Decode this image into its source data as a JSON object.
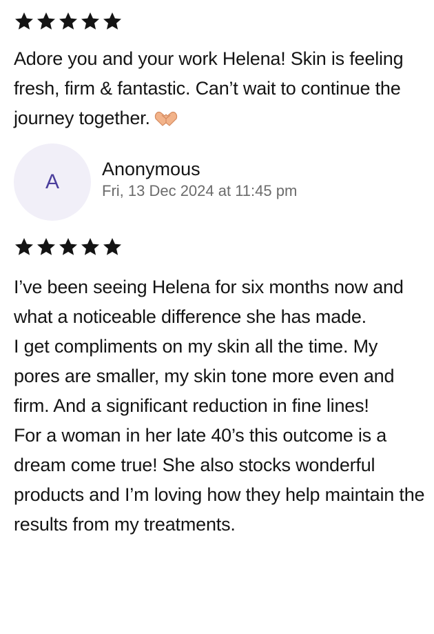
{
  "review_1": {
    "rating": 5,
    "text": "Adore you and your work Helena! Skin is feeling  fresh, firm & fantastic. Can’t wait to continue the journey together.",
    "emoji": "heart-hands"
  },
  "review_2": {
    "reviewer": {
      "initial": "A",
      "name": "Anonymous",
      "date": "Fri, 13 Dec 2024 at 11:45 pm"
    },
    "rating": 5,
    "text": "I’ve been seeing Helena for six months now and what a noticeable difference she has made.\nI get compliments on my skin all the time. My pores are smaller, my skin tone more even and firm. And a significant reduction in fine lines!\nFor a woman in her late 40’s this outcome is a dream come true! She also stocks wonderful products and I’m loving how they help maintain the results from my treatments."
  },
  "colors": {
    "star": "#141414",
    "avatar_bg": "#f1eff8",
    "avatar_text": "#4b3e9c",
    "date_text": "#6b6b6b"
  },
  "icons": [
    "star-icon",
    "heart-hands-emoji"
  ]
}
